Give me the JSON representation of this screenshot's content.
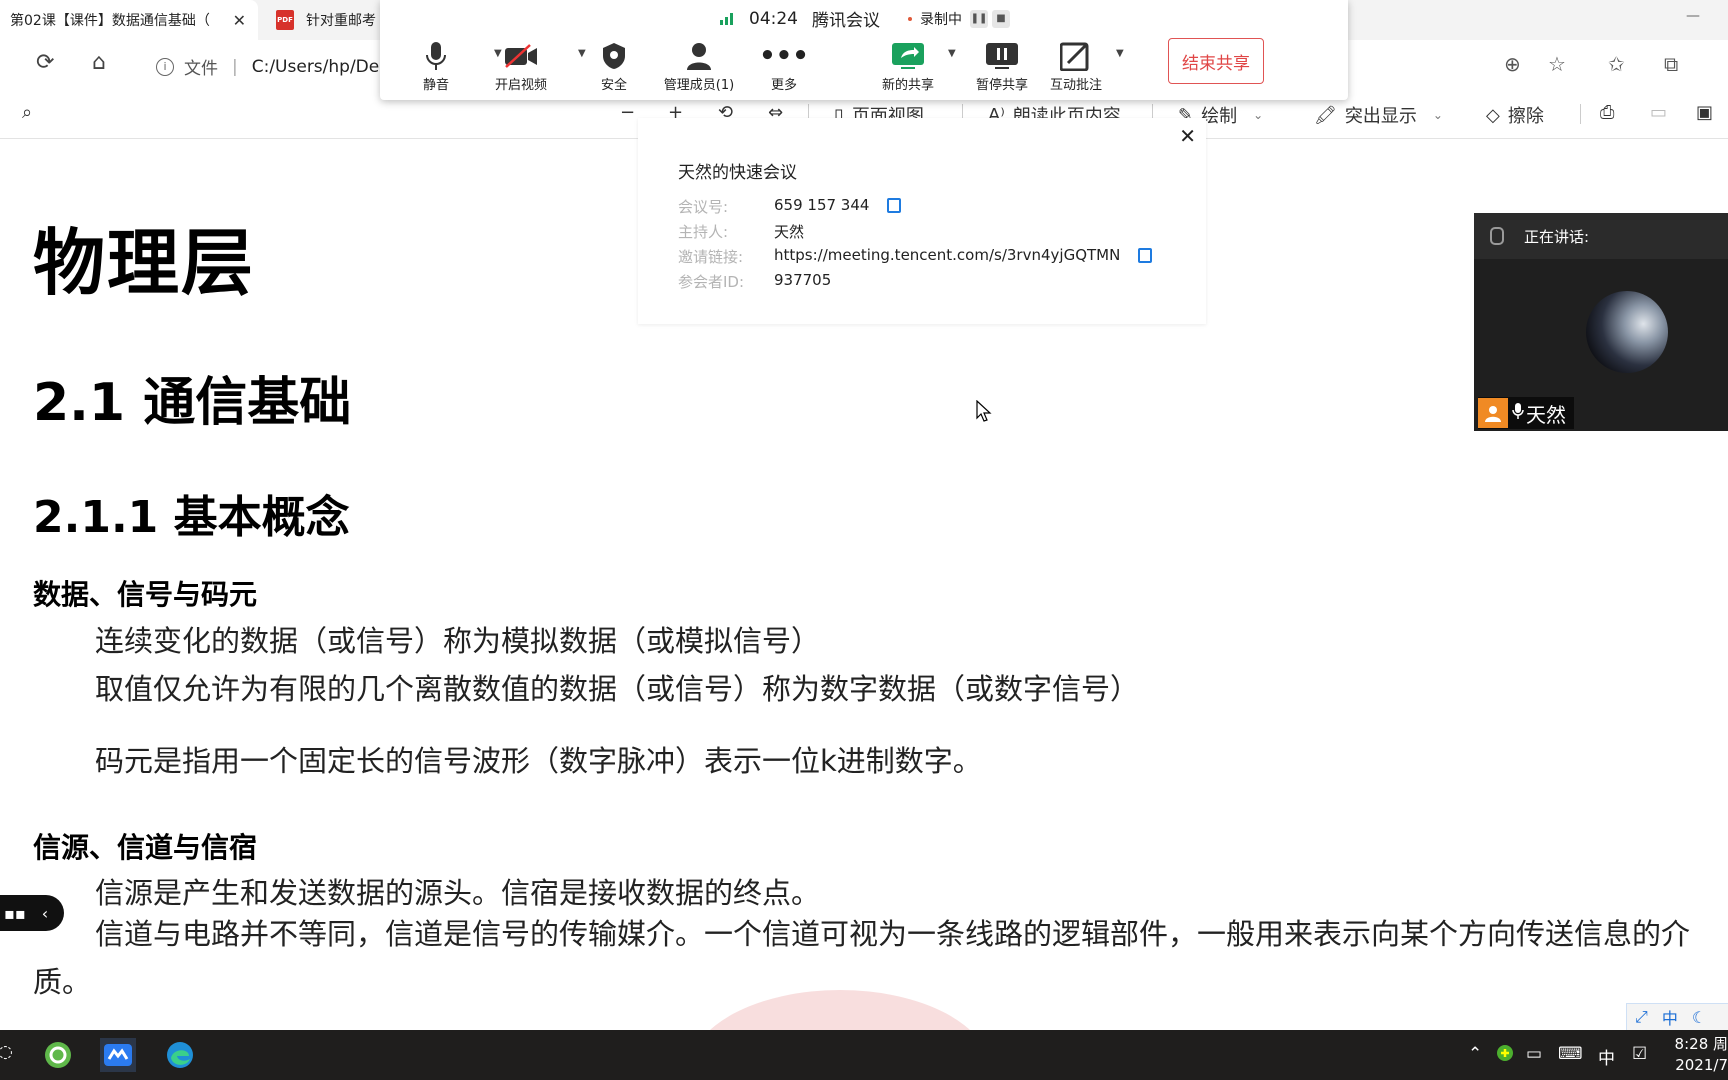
{
  "browser": {
    "tabs": [
      {
        "title": "第02课【课件】数据通信基础（",
        "active": true
      },
      {
        "title": "针对重邮考",
        "active": false
      }
    ],
    "address": {
      "scheme_label": "文件",
      "url": "C:/Users/hp/Desk"
    }
  },
  "pdf_toolbar": {
    "page_view": "页面视图",
    "read_aloud": "朗读此页内容",
    "draw": "绘制",
    "highlight": "突出显示",
    "erase": "擦除"
  },
  "meeting": {
    "timer": "04:24",
    "app_name": "腾讯会议",
    "recording": "录制中",
    "buttons": {
      "mute": "静音",
      "video": "开启视频",
      "security": "安全",
      "manage": "管理成员(1)",
      "more": "更多",
      "new_share": "新的共享",
      "pause_share": "暂停共享",
      "annotate": "互动批注"
    },
    "end_share": "结束共享",
    "info": {
      "title": "天然的快速会议",
      "rows": [
        {
          "key": "会议号:",
          "value": "659 157 344"
        },
        {
          "key": "主持人:",
          "value": "天然"
        },
        {
          "key": "邀请链接:",
          "value": "https://meeting.tencent.com/s/3rvn4yjGQTMN"
        },
        {
          "key": "参会者ID:",
          "value": "937705"
        }
      ]
    },
    "speaker": {
      "label": "正在讲话:",
      "name": "天然"
    }
  },
  "document": {
    "title": "物理层",
    "h2": "2.1 通信基础",
    "h3": "2.1.1 基本概念",
    "section1": {
      "heading": "数据、信号与码元",
      "lines": [
        "连续变化的数据（或信号）称为模拟数据（或模拟信号）",
        "取值仅允许为有限的几个离散数值的数据（或信号）称为数字数据（或数字信号）",
        "码元是指用一个固定长的信号波形（数字脉冲）表示一位k进制数字。"
      ]
    },
    "section2": {
      "heading": "信源、信道与信宿",
      "line1": "信源是产生和发送数据的源头。信宿是接收数据的终点。",
      "para2": "信道与电路并不等同，信道是信号的传输媒介。一个信道可视为一条线路的逻辑部件，一般用来表示向某个方向传送信息的介质。"
    }
  },
  "ime": {
    "mode": "中"
  },
  "taskbar": {
    "tray_ime": "中",
    "time": "8:28 周",
    "date": "2021/7"
  }
}
